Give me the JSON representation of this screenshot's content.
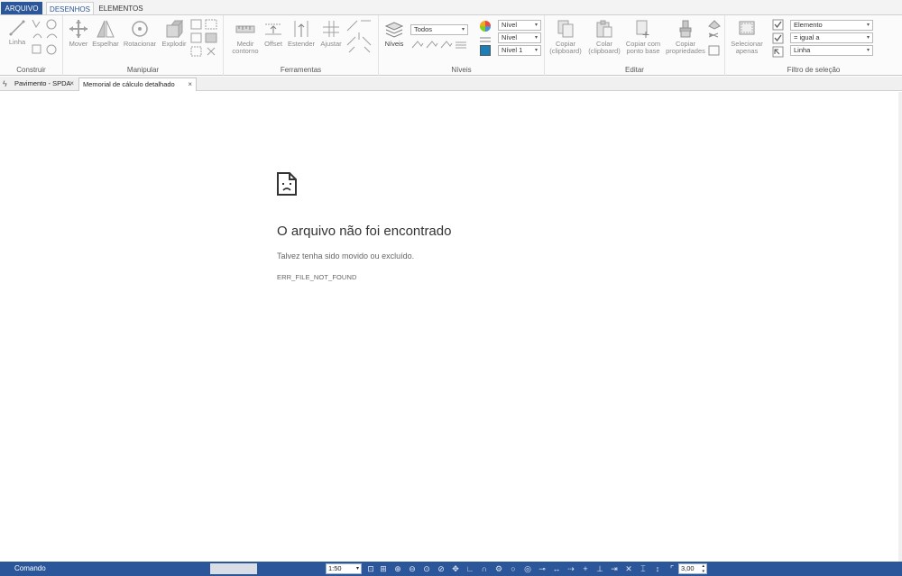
{
  "ribbon_tabs": [
    "ARQUIVO",
    "DESENHOS",
    "ELEMENTOS"
  ],
  "groups": {
    "construir": {
      "title": "Construir",
      "tools": [
        "Linha"
      ]
    },
    "manipular": {
      "title": "Manipular",
      "tools": [
        "Mover",
        "Espelhar",
        "Rotacionar",
        "Explodir"
      ]
    },
    "ferramentas": {
      "title": "Ferramentas",
      "tools": [
        "Medir contorno",
        "Offset",
        "Estender",
        "Ajustar"
      ]
    },
    "niveis": {
      "title": "Níveis",
      "tool": "Níveis",
      "filter_value": "Todos",
      "nivel_combo_1": "Nível",
      "nivel_combo_2": "Nível",
      "nivel_combo_3": "Nível 1"
    },
    "editar": {
      "title": "Editar",
      "tools": [
        "Copiar (clipboard)",
        "Colar (clipboard)",
        "Copiar com ponto base",
        "Copiar propriedades"
      ]
    },
    "filtro": {
      "title": "Filtro de seleção",
      "tool": "Selecionar apenas",
      "combo_1": "Elemento",
      "combo_2": "= igual a",
      "combo_3": "Linha"
    }
  },
  "doc_tabs": [
    "Pavimento - SPDA",
    "Memorial de cálculo detalhado (SPDA)"
  ],
  "error": {
    "title": "O arquivo não foi encontrado",
    "subtitle": "Talvez tenha sido movido ou excluído.",
    "code": "ERR_FILE_NOT_FOUND"
  },
  "statusbar": {
    "command_label": "Comando",
    "scale": "1:50",
    "line_width": "3,00"
  },
  "colors": {
    "accent": "#2b579a",
    "level_color": "#1a7fb8"
  }
}
